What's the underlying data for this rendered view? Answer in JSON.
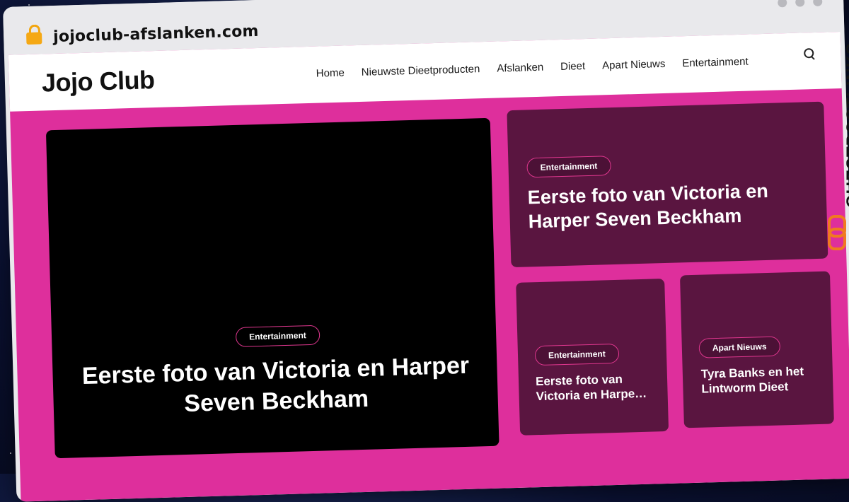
{
  "browser": {
    "url": "jojoclub-afslanken.com"
  },
  "site": {
    "logo": "Jojo Club",
    "menu": [
      "Home",
      "Nieuwste Dieetproducten",
      "Afslanken",
      "Dieet",
      "Apart Nieuws",
      "Entertainment"
    ]
  },
  "cards": {
    "hero": {
      "tag": "Entertainment",
      "title": "Eerste foto van Victoria en Harper Seven Beckham"
    },
    "top_right": {
      "tag": "Entertainment",
      "title": "Eerste foto van Victoria en Harper Seven Beckham"
    },
    "bottom_left": {
      "tag": "Entertainment",
      "title": "Eerste foto van Victoria en Harpe…"
    },
    "bottom_right": {
      "tag": "Apart Nieuws",
      "title": "Tyra Banks en het Lintworm Dieet"
    }
  },
  "watermark": {
    "text": "GUESTPOSTLINKS"
  },
  "colors": {
    "page_bg": "#de2f9c",
    "card_bg": "#5a1540",
    "hero_bg": "#000000",
    "tag_border": "#e0378f"
  }
}
